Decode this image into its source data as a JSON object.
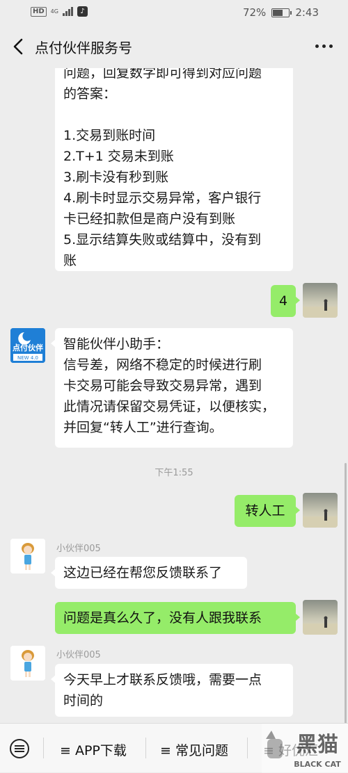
{
  "status_bar": {
    "hd": "HD",
    "network": "4G",
    "battery": "72%",
    "battery_level": 0.72,
    "time": "2:43",
    "icons": [
      "signal-icon",
      "tiktok-icon",
      "battery-icon"
    ]
  },
  "header": {
    "title": "点付伙伴服务号",
    "back_icon": "chevron-left-icon",
    "more_icon": "more-dots-icon"
  },
  "messages": [
    {
      "side": "left",
      "lines": [
        "问题，回复数字即可得到对应问题",
        "的答案：",
        "",
        "1.交易到账时间",
        "2.T+1 交易未到账",
        "3.刷卡没有秒到账",
        "4.刷卡时显示交易异常，客户银行",
        "卡已经扣款但是商户没有到账",
        "5.显示结算失败或结算中，没有到",
        "账"
      ]
    },
    {
      "side": "right",
      "text": "4"
    },
    {
      "side": "left",
      "logo_text": "点付伙伴",
      "logo_sub": "NEW 4.0",
      "lines": [
        "智能伙伴小助手：",
        "信号差，网络不稳定的时候进行刷",
        "卡交易可能会导致交易异常，遇到",
        "此情况请保留交易凭证，以便核实，",
        "并回复“转人工”进行查询。"
      ]
    },
    {
      "timestamp": "下午1:55"
    },
    {
      "side": "right",
      "text": "转人工"
    },
    {
      "side": "left",
      "sender": "小伙伴005",
      "text": "这边已经在帮您反馈联系了"
    },
    {
      "side": "right",
      "text": "问题是真么久了，没有人跟我联系"
    },
    {
      "side": "left",
      "sender": "小伙伴005",
      "lines": [
        "今天早上才联系反馈哦，需要一点",
        "时间的"
      ]
    }
  ],
  "bottom_menu": {
    "keyboard_icon": "keyboard-icon",
    "items": [
      "≡ APP下载",
      "≡ 常见问题",
      "≡ 好优汇"
    ]
  },
  "watermark": {
    "text": "黑猫",
    "sub": "BLACK CAT"
  },
  "colors": {
    "background": "#ededed",
    "bubble_self": "#95ec69",
    "bubble_other": "#ffffff",
    "logo_blue": "#1f7fd6"
  }
}
